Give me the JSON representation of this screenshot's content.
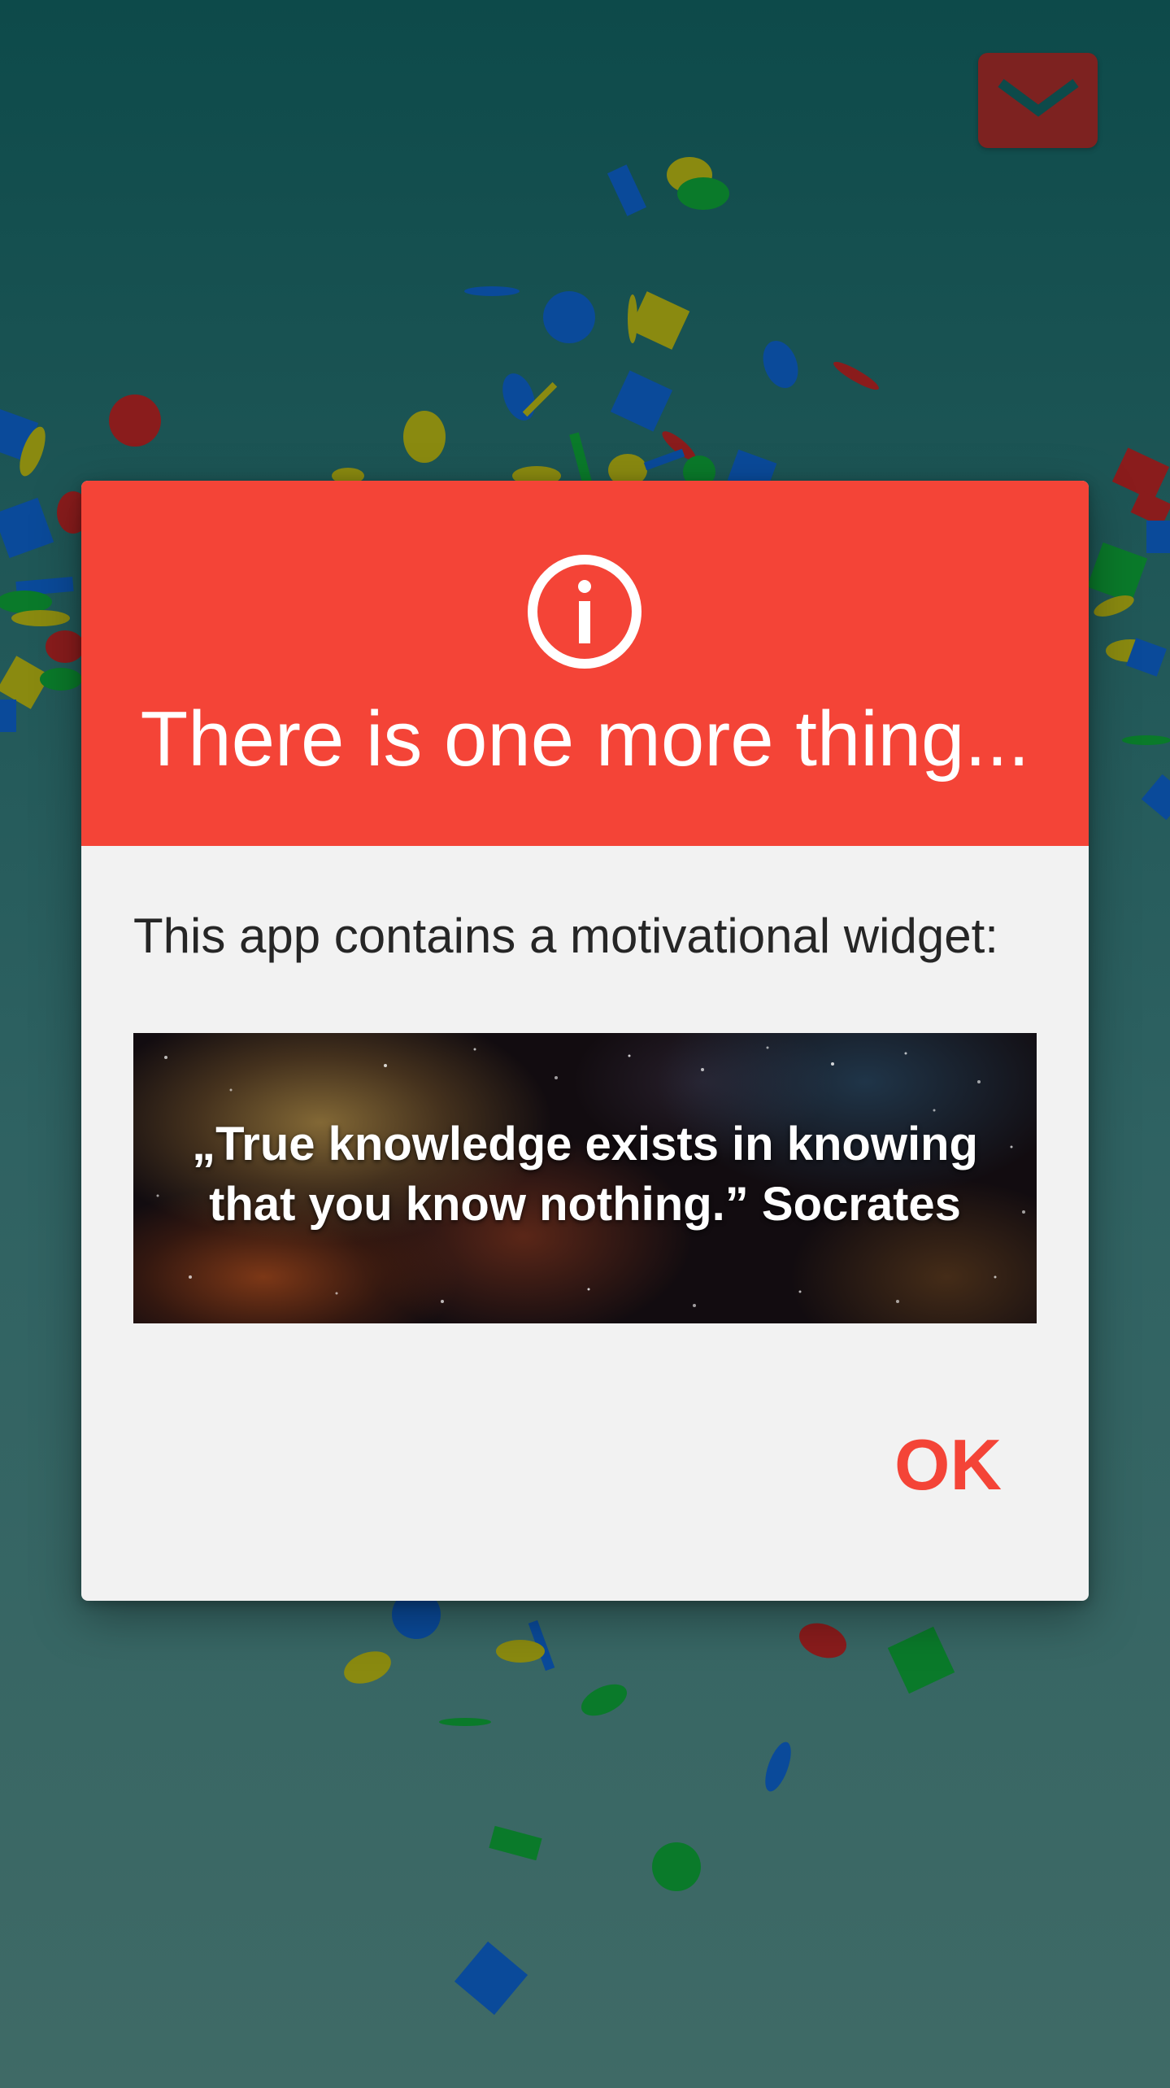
{
  "app": {
    "header": {
      "mail_icon": "envelope-icon",
      "mail_button_color": "#7d2220"
    },
    "background": {
      "gradient_top": "#0d4a4a",
      "gradient_bottom": "#3f6a66",
      "confetti_colors": [
        "#0a4a9a",
        "#8a1c1c",
        "#8a8a10",
        "#0a7a2a"
      ]
    }
  },
  "dialog": {
    "header_color": "#f44437",
    "icon": "info-icon",
    "title": "There is one more thing...",
    "message": "This app contains a motivational widget:",
    "widget": {
      "quote_line_1": "„True knowledge exists in knowing",
      "quote_line_2": "that you know nothing.” Socrates"
    },
    "ok_label": "OK"
  }
}
